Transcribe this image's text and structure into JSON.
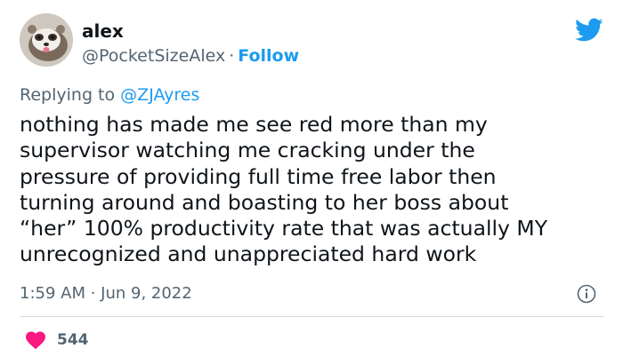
{
  "author": {
    "name": "alex",
    "handle": "@PocketSizeAlex",
    "separator": "·",
    "follow_label": "Follow"
  },
  "reply": {
    "prefix": "Replying to",
    "mention": "@ZJAyres"
  },
  "tweet_lines": [
    "nothing has made me see red more than my",
    "supervisor watching me cracking under the",
    "pressure of providing full time free labor then",
    "turning around and boasting to her boss about",
    "“her” 100% productivity rate that was actually MY",
    "unrecognized and unappreciated hard work"
  ],
  "timestamp": "1:59 AM · Jun 9, 2022",
  "likes": "544",
  "icons": {
    "brand": "twitter-bird-icon",
    "info": "info-icon",
    "like": "heart-icon"
  },
  "colors": {
    "accent": "#1d9bf0",
    "heart": "#f91880",
    "muted": "#536471"
  }
}
